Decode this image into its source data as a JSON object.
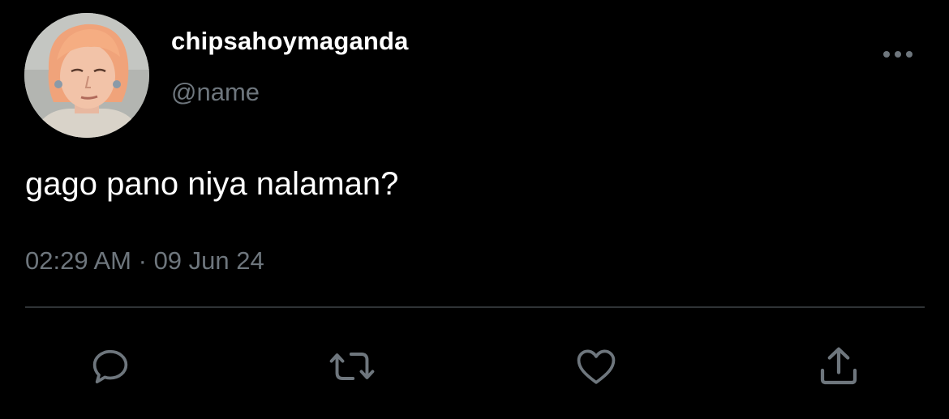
{
  "tweet": {
    "display_name": "chipsahoymaganda",
    "handle": "@name",
    "text": "gago pano niya nalaman?",
    "time": "02:29 AM",
    "separator": "·",
    "date": "09 Jun 24"
  },
  "icons": {
    "avatar": "profile-photo",
    "more": "more-horizontal-icon",
    "reply": "reply-icon",
    "retweet": "retweet-icon",
    "like": "like-heart-icon",
    "share": "share-icon"
  },
  "colors": {
    "background": "#000000",
    "primary_text": "#ffffff",
    "secondary_text": "#6e767d",
    "divider": "#2f3336"
  }
}
